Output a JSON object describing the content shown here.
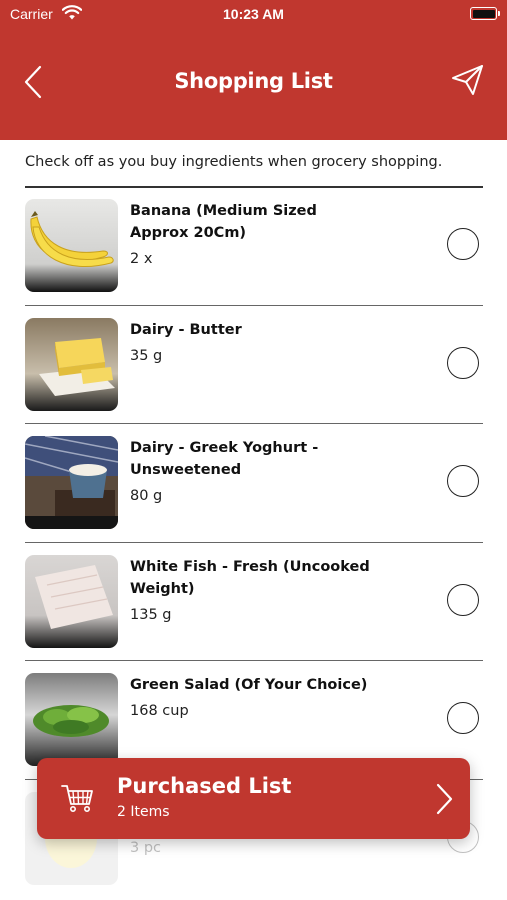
{
  "status_bar": {
    "carrier": "Carrier",
    "time": "10:23 AM"
  },
  "nav": {
    "title": "Shopping List"
  },
  "instructions": "Check off as you buy ingredients when grocery shopping.",
  "items": [
    {
      "name": "Banana (Medium Sized Approx 20Cm)",
      "qty": "2 x",
      "image": "banana-image",
      "checked": false
    },
    {
      "name": "Dairy - Butter",
      "qty": "35 g",
      "image": "butter-image",
      "checked": false
    },
    {
      "name": "Dairy - Greek Yoghurt - Unsweetened",
      "qty": "80 g",
      "image": "yoghurt-image",
      "checked": false
    },
    {
      "name": "White Fish - Fresh (Uncooked Weight)",
      "qty": "135 g",
      "image": "fish-image",
      "checked": false
    },
    {
      "name": "Green Salad (Of Your Choice)",
      "qty": "168 cup",
      "image": "salad-image",
      "checked": false
    },
    {
      "name": "",
      "qty": "3 pc",
      "image": "partial-item-image",
      "checked": false
    }
  ],
  "purchased": {
    "title": "Purchased List",
    "count": "2 Items"
  },
  "colors": {
    "brand": "#c0372f",
    "text": "#111111",
    "divider": "#333333"
  },
  "icons": {
    "back": "chevron-left-icon",
    "send": "paper-plane-icon",
    "cart": "shopping-cart-icon",
    "forward": "chevron-right-icon"
  }
}
